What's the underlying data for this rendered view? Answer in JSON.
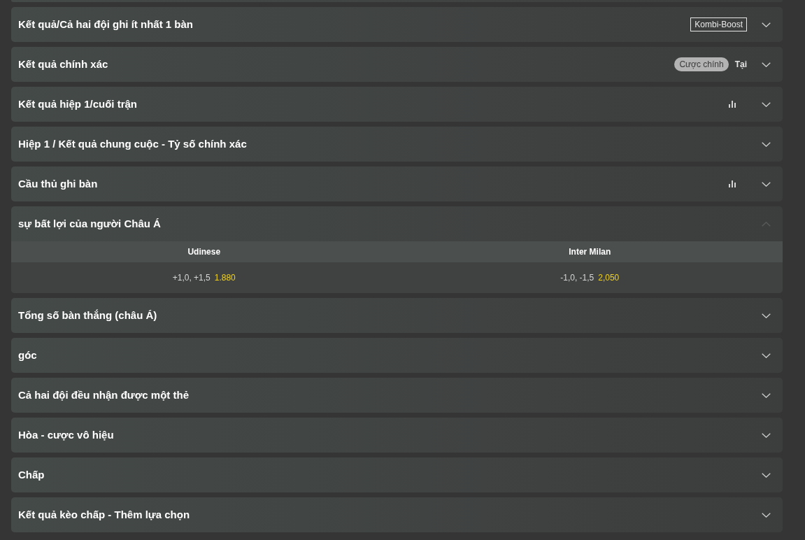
{
  "markets": [
    {
      "title": "Kết quả/Cả hai đội ghi ít nhất 1 bàn",
      "expanded": false,
      "stats": false,
      "tags": [
        {
          "kind": "outline",
          "label": "Kombi-Boost"
        }
      ]
    },
    {
      "title": "Kết quả chính xác",
      "expanded": false,
      "stats": false,
      "tags": [
        {
          "kind": "pill",
          "label": "Cược chính"
        },
        {
          "kind": "plain",
          "label": "Tại"
        }
      ]
    },
    {
      "title": "Kết quả hiệp 1/cuối trận",
      "expanded": false,
      "stats": true
    },
    {
      "title": "Hiệp 1 / Kết quả chung cuộc - Tỷ số chính xác",
      "expanded": false,
      "stats": false
    },
    {
      "title": "Cầu thủ ghi bàn",
      "expanded": false,
      "stats": true
    },
    {
      "title": "sự bất lợi của người Châu Á",
      "expanded": true,
      "stats": false,
      "columns": [
        "Udinese",
        "Inter Milan"
      ],
      "selections": [
        {
          "line": "+1,0, +1,5",
          "odds": "1.880"
        },
        {
          "line": "-1,0, -1,5",
          "odds": "2,050"
        }
      ]
    },
    {
      "title": "Tổng số bàn thắng (châu Á)",
      "expanded": false,
      "stats": false
    },
    {
      "title": "góc",
      "expanded": false,
      "stats": false
    },
    {
      "title": "Cả hai đội đều nhận được một thẻ",
      "expanded": false,
      "stats": false
    },
    {
      "title": "Hòa - cược vô hiệu",
      "expanded": false,
      "stats": false
    },
    {
      "title": "Chấp",
      "expanded": false,
      "stats": false
    },
    {
      "title": "Kết quả kèo chấp - Thêm lựa chọn",
      "expanded": false,
      "stats": false
    }
  ]
}
